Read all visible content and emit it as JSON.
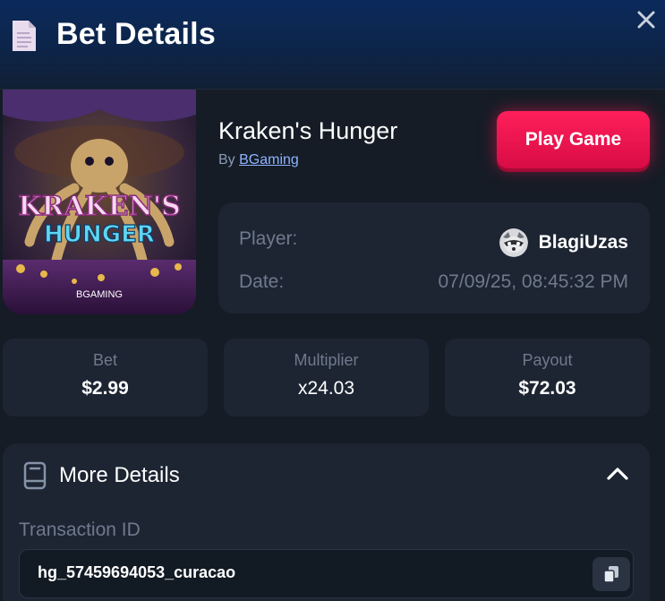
{
  "header": {
    "title": "Bet Details",
    "icon": "document-icon",
    "close_icon": "close-icon"
  },
  "game": {
    "name": "Kraken's Hunger",
    "by_prefix": "By",
    "provider": "BGaming",
    "cover": {
      "title_line1": "KRAKEN'S",
      "title_line2": "HUNGER",
      "brand": "BGAMING"
    },
    "play_button": "Play Game"
  },
  "info": {
    "player_label": "Player:",
    "player_name": "BlagiUzas",
    "date_label": "Date:",
    "date_value": "07/09/25, 08:45:32 PM"
  },
  "stats": [
    {
      "label": "Bet",
      "value": "$2.99"
    },
    {
      "label": "Multiplier",
      "value": "x24.03"
    },
    {
      "label": "Payout",
      "value": "$72.03"
    }
  ],
  "more_details": {
    "title": "More Details",
    "transaction_label": "Transaction ID",
    "transaction_id": "hg_57459694053_curacao"
  },
  "colors": {
    "accent": "#e8124c",
    "background": "#151c26",
    "card": "#1d2533",
    "muted": "#6f7a8c"
  }
}
